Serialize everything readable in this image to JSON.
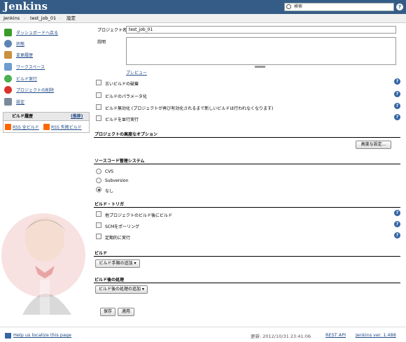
{
  "header": {
    "logo": "Jenkins",
    "search_placeholder": "検索",
    "help": "?"
  },
  "breadcrumbs": [
    "Jenkins",
    "test_job_01",
    "設定"
  ],
  "sidebar": {
    "tasks": [
      {
        "label": "ダッシュボードへ戻る",
        "icon": "up-arrow-icon",
        "color": "#3a9b2a"
      },
      {
        "label": "状態",
        "icon": "magnifier-icon",
        "color": "#5b84b1"
      },
      {
        "label": "変更履歴",
        "icon": "notepad-icon",
        "color": "#c89040"
      },
      {
        "label": "ワークスペース",
        "icon": "folder-icon",
        "color": "#6e9bd0"
      },
      {
        "label": "ビルド実行",
        "icon": "clock-icon",
        "color": "#4caf50"
      },
      {
        "label": "プロジェクトの削除",
        "icon": "no-entry-icon",
        "color": "#d9322b"
      },
      {
        "label": "設定",
        "icon": "wrench-icon",
        "color": "#7a8a9a"
      }
    ],
    "build_history": {
      "title": "ビルド履歴",
      "trend": "(推移)",
      "rss_all": "RSS 全ビルド",
      "rss_failed": "RSS 失敗ビルド"
    }
  },
  "form": {
    "project_name_label": "プロジェクト名",
    "project_name_value": "test_job_01",
    "description_label": "説明",
    "preview": "プレビュー",
    "options": [
      "古いビルドの破棄",
      "ビルドのパラメータ化",
      "ビルド無効化 (プロジェクトが再び有効化されるまで新しいビルドは行われなくなります)",
      "ビルドを並行実行"
    ],
    "advanced_section": "プロジェクトの高度なオプション",
    "advanced_button": "高度な設定...",
    "scm_section": "ソースコード管理システム",
    "scm_options": [
      "CVS",
      "Subversion",
      "なし"
    ],
    "scm_selected": "なし",
    "trigger_section": "ビルド・トリガ",
    "triggers": [
      "他プロジェクトのビルド後にビルド",
      "SCMをポーリング",
      "定期的に実行"
    ],
    "build_section": "ビルド",
    "add_build_step": "ビルド手順の追加 ▾",
    "post_section": "ビルド後の処理",
    "add_post_step": "ビルド後の処理の追加 ▾",
    "save": "保存",
    "apply": "適用"
  },
  "footer": {
    "localize": "Help us localize this page",
    "updated": "更新: 2012/10/31 23:41:06",
    "rest_api": "REST API",
    "version": "Jenkins ver. 1.488"
  },
  "colors": {
    "header_bg": "#355c86",
    "link": "#204a87"
  }
}
